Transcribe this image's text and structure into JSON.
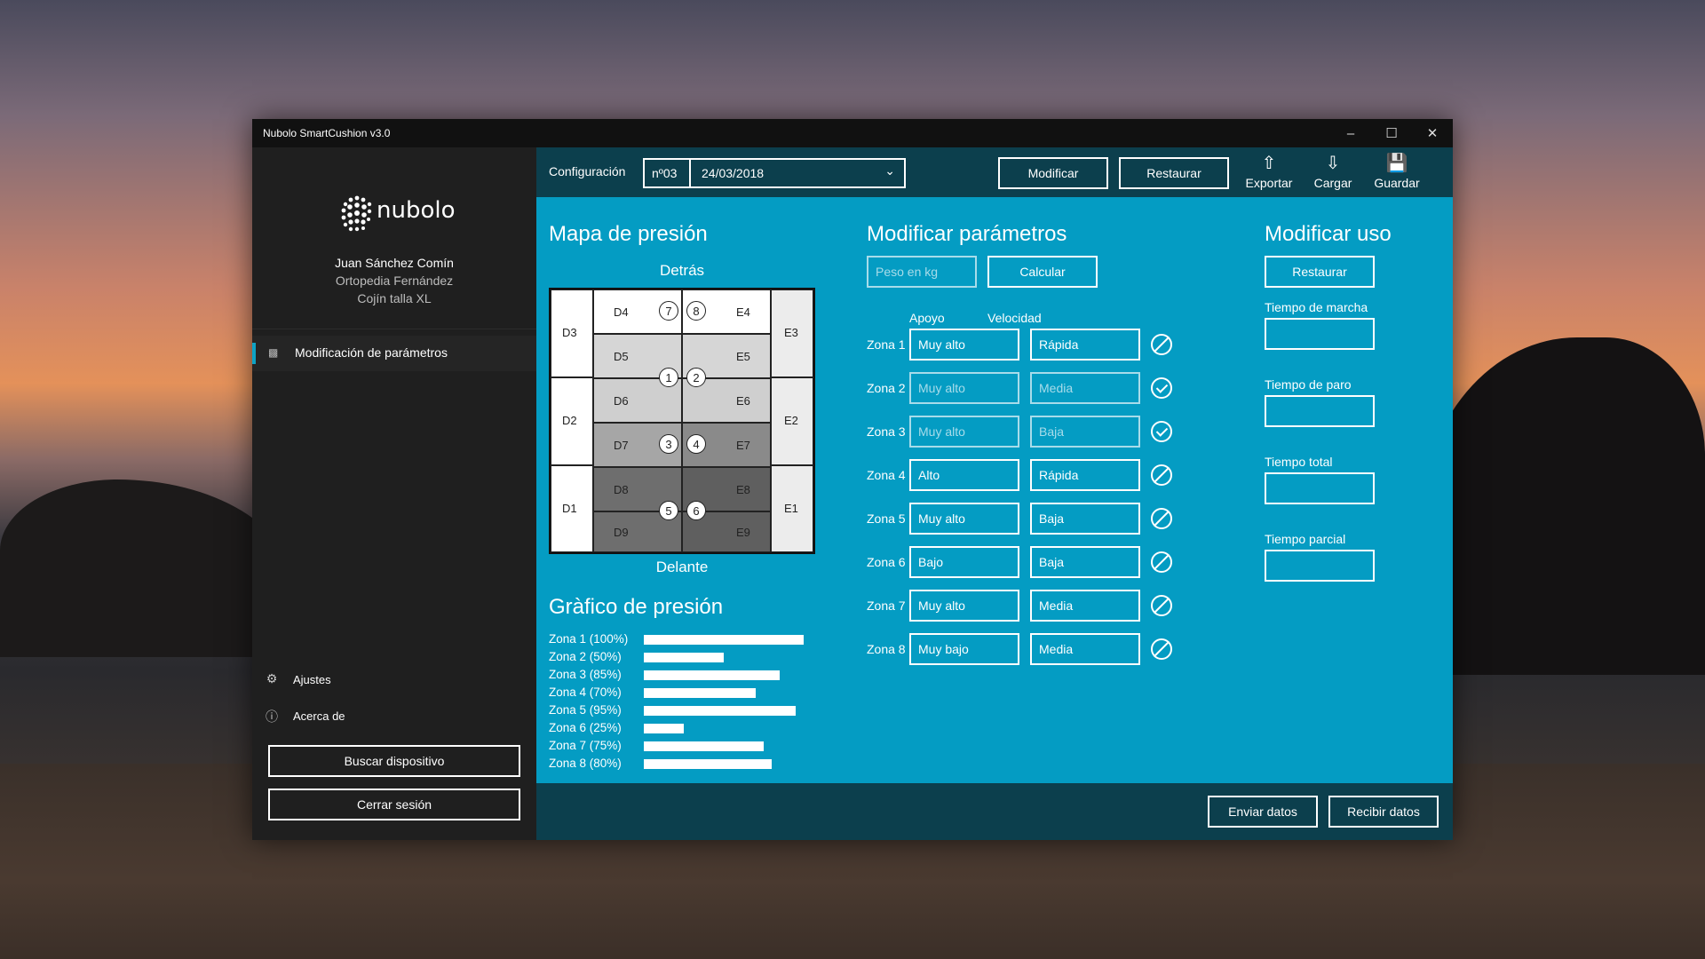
{
  "window": {
    "title": "Nubolo SmartCushion v3.0",
    "minimize_icon": "minimize-icon",
    "maximize_icon": "maximize-icon",
    "close_icon": "close-icon"
  },
  "sidebar": {
    "logo_text": "nubolo",
    "user_name": "Juan Sánchez Comín",
    "clinic": "Ortopedia Fernández",
    "cushion": "Cojín talla XL",
    "nav_items": [
      {
        "label": "Modificación de parámetros",
        "icon": "cushion-icon",
        "active": true
      }
    ],
    "settings_label": "Ajustes",
    "about_label": "Acerca de",
    "search_device_label": "Buscar dispositivo",
    "logout_label": "Cerrar sesión"
  },
  "topbar": {
    "config_label": "Configuración",
    "config_number": "nº03",
    "config_date": "24/03/2018",
    "modify_label": "Modificar",
    "restore_label": "Restaurar",
    "export_label": "Exportar",
    "load_label": "Cargar",
    "save_label": "Guardar"
  },
  "pressure_map": {
    "title": "Mapa de presión",
    "back_label": "Detrás",
    "front_label": "Delante",
    "left_cells": [
      "D3",
      "D2",
      "D1"
    ],
    "right_cells": [
      "E3",
      "E2",
      "E1"
    ],
    "inner_left": [
      "D4",
      "D5",
      "D6",
      "D7",
      "D8",
      "D9"
    ],
    "inner_right": [
      "E4",
      "E5",
      "E6",
      "E7",
      "E8",
      "E9"
    ],
    "sensors": [
      "7",
      "8",
      "1",
      "2",
      "3",
      "4",
      "5",
      "6"
    ],
    "shade_colors": [
      "#ffffff",
      "#d6d6d6",
      "#cfcfcf",
      "#a6a6a6",
      "#6e6e6e",
      "#5f5f5f"
    ]
  },
  "pressure_chart": {
    "title": "Gràfico de presión",
    "rows": [
      {
        "label": "Zona 1 (100%)",
        "value": 100
      },
      {
        "label": "Zona 2 (50%)",
        "value": 50
      },
      {
        "label": "Zona 3 (85%)",
        "value": 85
      },
      {
        "label": "Zona 4 (70%)",
        "value": 70
      },
      {
        "label": "Zona 5 (95%)",
        "value": 95
      },
      {
        "label": "Zona 6 (25%)",
        "value": 25
      },
      {
        "label": "Zona 7 (75%)",
        "value": 75
      },
      {
        "label": "Zona 8 (80%)",
        "value": 80
      }
    ]
  },
  "params": {
    "title": "Modificar parámetros",
    "weight_placeholder": "Peso en kg",
    "calculate_label": "Calcular",
    "support_header": "Apoyo",
    "speed_header": "Velocidad",
    "zones": [
      {
        "label": "Zona 1",
        "support": "Muy alto",
        "speed": "Rápida",
        "enabled": true,
        "state": "no"
      },
      {
        "label": "Zona 2",
        "support": "Muy alto",
        "speed": "Media",
        "enabled": false,
        "state": "ok"
      },
      {
        "label": "Zona 3",
        "support": "Muy alto",
        "speed": "Baja",
        "enabled": false,
        "state": "ok"
      },
      {
        "label": "Zona 4",
        "support": "Alto",
        "speed": "Rápida",
        "enabled": true,
        "state": "no"
      },
      {
        "label": "Zona 5",
        "support": "Muy alto",
        "speed": "Baja",
        "enabled": true,
        "state": "no"
      },
      {
        "label": "Zona 6",
        "support": "Bajo",
        "speed": "Baja",
        "enabled": true,
        "state": "no"
      },
      {
        "label": "Zona 7",
        "support": "Muy alto",
        "speed": "Media",
        "enabled": true,
        "state": "no"
      },
      {
        "label": "Zona 8",
        "support": "Muy bajo",
        "speed": "Media",
        "enabled": true,
        "state": "no"
      }
    ]
  },
  "usage": {
    "title": "Modificar uso",
    "restore_label": "Restaurar",
    "fields": [
      "Tiempo de marcha",
      "Tiempo de paro",
      "Tiempo total",
      "Tiempo parcial"
    ]
  },
  "bottombar": {
    "send_label": "Enviar datos",
    "receive_label": "Recibir datos"
  },
  "colors": {
    "accent": "#049cc3",
    "dark_bar": "#0c3f4d",
    "sidebar": "#1f1f1f"
  }
}
